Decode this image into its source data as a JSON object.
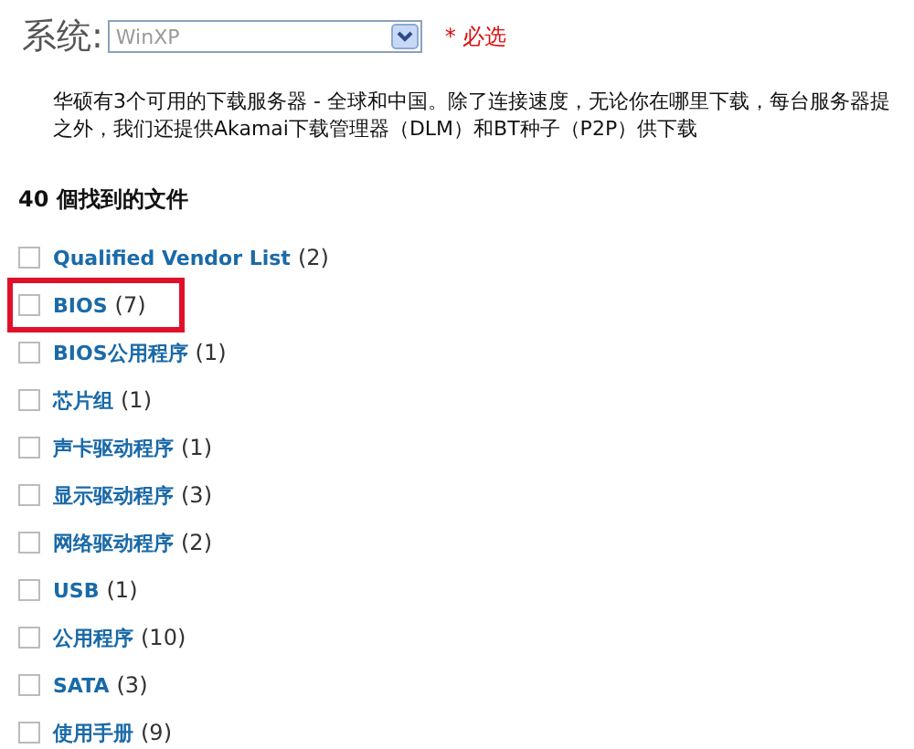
{
  "os_filter": {
    "label": "系统:",
    "value": "WinXP",
    "required_note": "* 必选"
  },
  "description": [
    "华硕有3个可用的下载服务器 - 全球和中国。除了连接速度，无论你在哪里下载，每台服务器提",
    "之外，我们还提供Akamai下载管理器（DLM）和BT种子（P2P）供下载"
  ],
  "results": {
    "heading": "40 個找到的文件",
    "items": [
      {
        "label": "Qualified Vendor List",
        "count": "(2)",
        "checked": false,
        "highlighted": false
      },
      {
        "label": "BIOS",
        "count": "(7)",
        "checked": false,
        "highlighted": true
      },
      {
        "label": "BIOS公用程序",
        "count": "(1)",
        "checked": false,
        "highlighted": false
      },
      {
        "label": "芯片组",
        "count": "(1)",
        "checked": false,
        "highlighted": false
      },
      {
        "label": "声卡驱动程序",
        "count": "(1)",
        "checked": false,
        "highlighted": false
      },
      {
        "label": "显示驱动程序",
        "count": "(3)",
        "checked": false,
        "highlighted": false
      },
      {
        "label": "网络驱动程序",
        "count": "(2)",
        "checked": false,
        "highlighted": false
      },
      {
        "label": "USB",
        "count": "(1)",
        "checked": false,
        "highlighted": false
      },
      {
        "label": "公用程序",
        "count": "(10)",
        "checked": false,
        "highlighted": false
      },
      {
        "label": "SATA",
        "count": "(3)",
        "checked": false,
        "highlighted": false
      },
      {
        "label": "使用手册",
        "count": "(9)",
        "checked": false,
        "highlighted": false
      }
    ]
  }
}
